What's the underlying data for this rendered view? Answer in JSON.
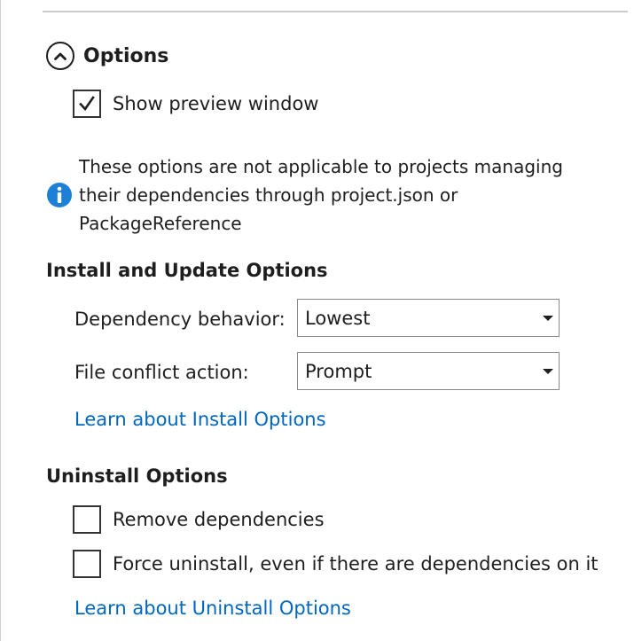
{
  "options_section": {
    "title": "Options",
    "expanded": true,
    "show_preview": {
      "label": "Show preview window",
      "checked": true
    },
    "info_message": "These options are not applicable to projects managing their dependencies through project.json or PackageReference"
  },
  "install_update": {
    "title": "Install and Update Options",
    "dependency_behavior": {
      "label": "Dependency behavior:",
      "value": "Lowest"
    },
    "file_conflict": {
      "label": "File conflict action:",
      "value": "Prompt"
    },
    "learn_link": "Learn about Install Options"
  },
  "uninstall": {
    "title": "Uninstall Options",
    "remove_dependencies": {
      "label": "Remove dependencies",
      "checked": false
    },
    "force_uninstall": {
      "label": "Force uninstall, even if there are dependencies on it",
      "checked": false
    },
    "learn_link": "Learn about Uninstall Options"
  },
  "colors": {
    "link": "#0066bf",
    "info_icon": "#1e7fd6",
    "text": "#1e1e1e"
  },
  "icons": {
    "collapse": "chevron-up-icon",
    "info": "info-icon",
    "check": "checkmark-icon",
    "dropdown": "triangle-down-icon"
  }
}
